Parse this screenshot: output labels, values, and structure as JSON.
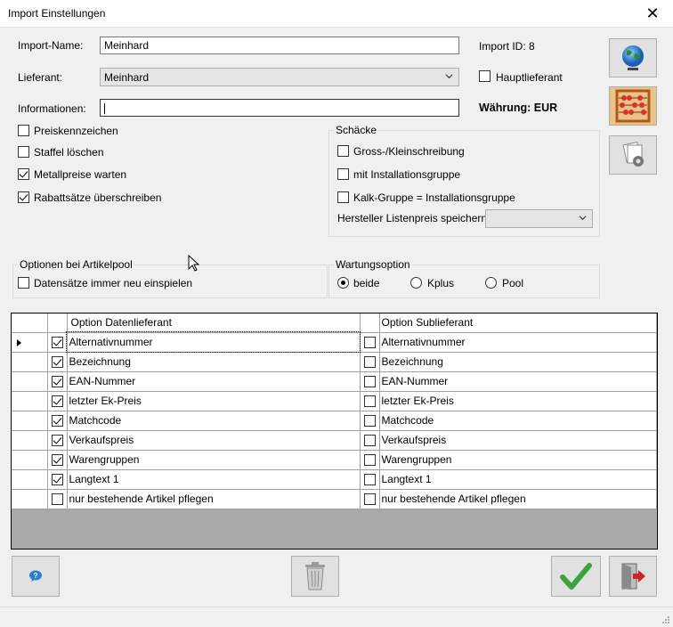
{
  "window": {
    "title": "Import Einstellungen"
  },
  "form": {
    "import_name_label": "Import-Name:",
    "import_name_value": "Meinhard",
    "import_id_label": "Import ID: 8",
    "lieferant_label": "Lieferant:",
    "lieferant_value": "Meinhard",
    "hauptlieferant_label": "Hauptlieferant",
    "informationen_label": "Informationen:",
    "informationen_value": "",
    "waehrung_label": "Währung: EUR"
  },
  "options_left": [
    {
      "label": "Preiskennzeichen",
      "checked": false
    },
    {
      "label": "Staffel löschen",
      "checked": false
    },
    {
      "label": "Metallpreise warten",
      "checked": true
    },
    {
      "label": "Rabattsätze überschreiben",
      "checked": true
    }
  ],
  "schaecke": {
    "title": "Schäcke",
    "gross_klein": "Gross-/Kleinschreibung",
    "mit_install": "mit Installationsgruppe",
    "kalk_gruppe": "Kalk-Gruppe = Installationsgruppe",
    "hersteller_label": "Hersteller Listenpreis speichern in",
    "hersteller_value": ""
  },
  "artikelpool": {
    "title": "Optionen bei Artikelpool",
    "datensaetze": "Datensätze immer neu einspielen"
  },
  "wartung": {
    "title": "Wartungsoption",
    "options": [
      "beide",
      "Kplus",
      "Pool"
    ],
    "selected": "beide"
  },
  "grid": {
    "col_datenlieferant": "Option Datenlieferant",
    "col_sublieferant": "Option Sublieferant",
    "rows": [
      {
        "label": "Alternativnummer",
        "daten": true,
        "sub": false
      },
      {
        "label": "Bezeichnung",
        "daten": true,
        "sub": false
      },
      {
        "label": "EAN-Nummer",
        "daten": true,
        "sub": false
      },
      {
        "label": "letzter Ek-Preis",
        "daten": true,
        "sub": false
      },
      {
        "label": "Matchcode",
        "daten": true,
        "sub": false
      },
      {
        "label": "Verkaufspreis",
        "daten": true,
        "sub": false
      },
      {
        "label": "Warengruppen",
        "daten": true,
        "sub": false
      },
      {
        "label": "Langtext 1",
        "daten": true,
        "sub": false
      },
      {
        "label": "nur bestehende Artikel pflegen",
        "daten": false,
        "sub": false
      }
    ]
  },
  "icons": {
    "globe": "globe-icon",
    "abacus": "abacus-icon",
    "settings": "settings-icon",
    "help": "help-icon",
    "trash": "trash-icon",
    "ok": "checkmark-icon",
    "exit": "exit-icon"
  },
  "colors": {
    "ok_green": "#3aa53a",
    "exit_red": "#d42020",
    "help_blue": "#2a7fd4"
  }
}
